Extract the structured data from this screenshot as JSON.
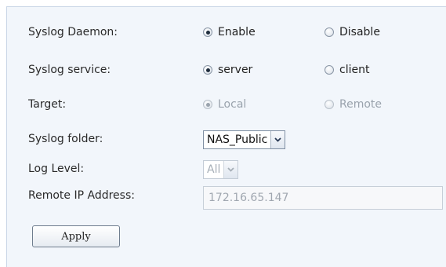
{
  "syslog_daemon": {
    "label": "Syslog Daemon:",
    "option_enable": "Enable",
    "option_disable": "Disable",
    "selected": "Enable"
  },
  "syslog_service": {
    "label": "Syslog service:",
    "option_server": "server",
    "option_client": "client",
    "selected": "server"
  },
  "target": {
    "label": "Target:",
    "option_local": "Local",
    "option_remote": "Remote",
    "selected": "Local",
    "disabled": true
  },
  "syslog_folder": {
    "label": "Syslog folder:",
    "value": "NAS_Public"
  },
  "log_level": {
    "label": "Log Level:",
    "value": "All",
    "disabled": true
  },
  "remote_ip": {
    "label": "Remote IP Address:",
    "value": "172.16.65.147",
    "disabled": true
  },
  "apply_label": "Apply",
  "icons": {
    "dropdown": "chevron-down-icon"
  }
}
